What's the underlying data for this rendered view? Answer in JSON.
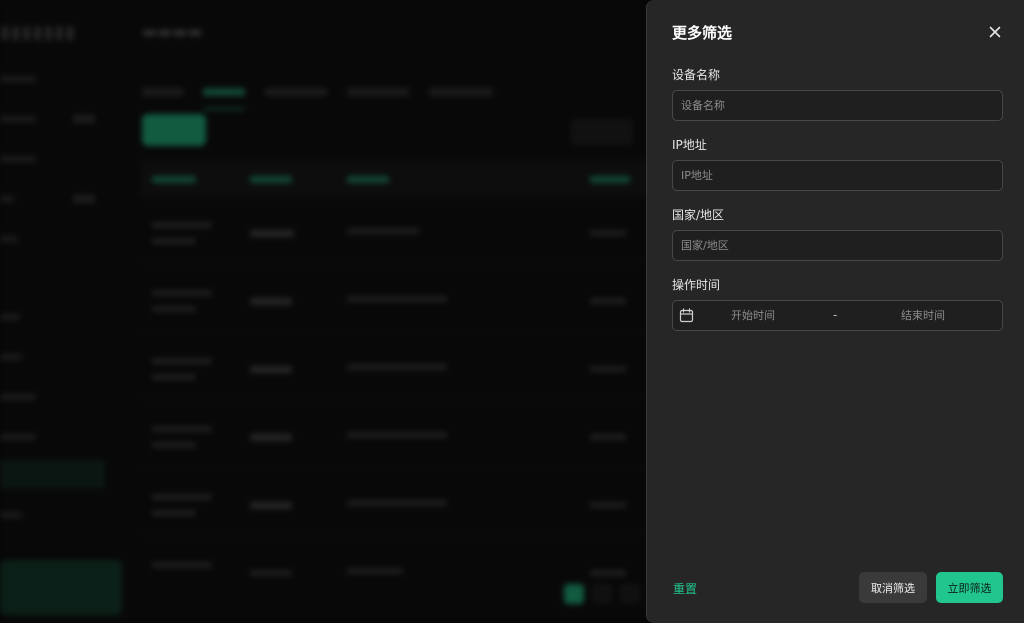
{
  "drawer": {
    "title": "更多筛选",
    "close_icon": "close-icon",
    "fields": {
      "device_name": {
        "label": "设备名称",
        "placeholder": "设备名称",
        "value": ""
      },
      "ip_address": {
        "label": "IP地址",
        "placeholder": "IP地址",
        "value": ""
      },
      "region": {
        "label": "国家/地区",
        "placeholder": "国家/地区",
        "value": ""
      },
      "time": {
        "label": "操作时间",
        "icon": "calendar-icon",
        "start_placeholder": "开始时间",
        "separator": "-",
        "end_placeholder": "结束时间"
      }
    },
    "footer": {
      "reset_label": "重置",
      "cancel_label": "取消筛选",
      "apply_label": "立即筛选"
    }
  },
  "colors": {
    "accent": "#21c58e",
    "drawer_bg": "#262626",
    "input_border": "#484848"
  }
}
